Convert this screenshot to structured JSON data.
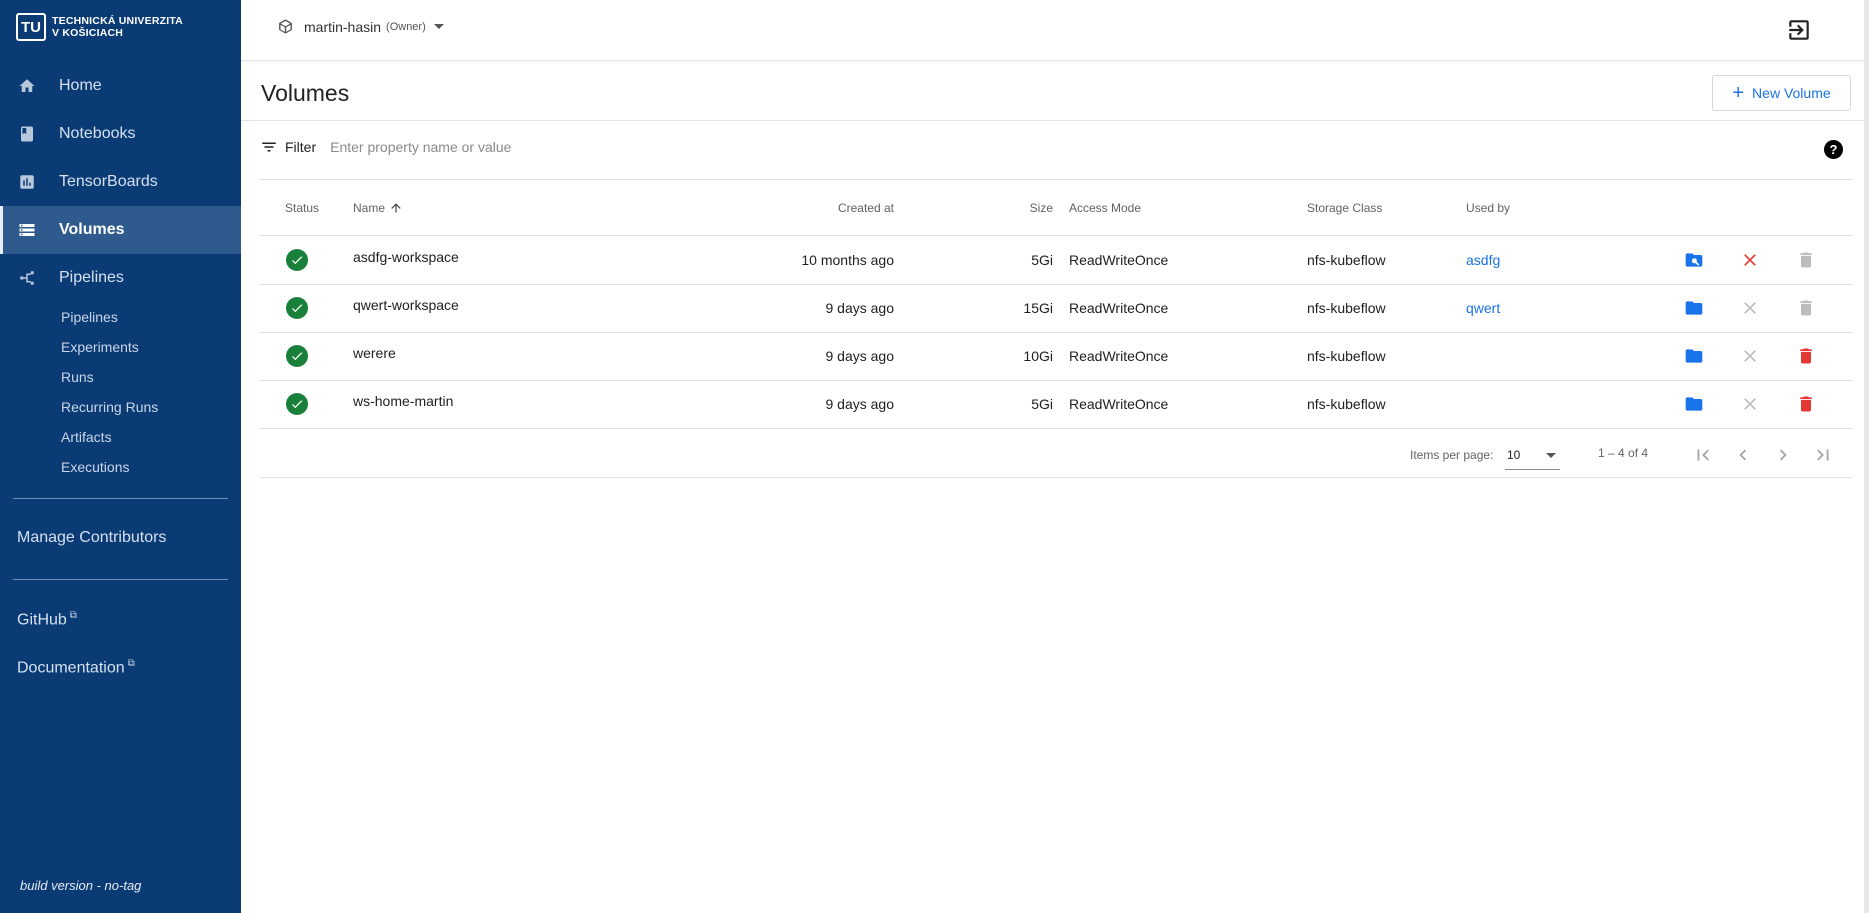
{
  "brand": {
    "logo_mark": "TU",
    "line1": "TECHNICKÁ UNIVERZITA",
    "line2": "V KOŠICIACH"
  },
  "sidebar": {
    "items": [
      {
        "label": "Home",
        "icon": "home-icon"
      },
      {
        "label": "Notebooks",
        "icon": "book-icon"
      },
      {
        "label": "TensorBoards",
        "icon": "chart-icon"
      },
      {
        "label": "Volumes",
        "icon": "list-icon",
        "active": true
      },
      {
        "label": "Pipelines",
        "icon": "pipeline-icon"
      }
    ],
    "sub_items": [
      "Pipelines",
      "Experiments",
      "Runs",
      "Recurring Runs",
      "Artifacts",
      "Executions"
    ],
    "manage_contributors": "Manage Contributors",
    "github": "GitHub",
    "documentation": "Documentation",
    "build_version": "build version - no-tag"
  },
  "topbar": {
    "namespace": "martin-hasin",
    "role": "(Owner)"
  },
  "page": {
    "title": "Volumes",
    "new_button": "New Volume"
  },
  "filter": {
    "label": "Filter",
    "placeholder": "Enter property name or value"
  },
  "table": {
    "headers": {
      "status": "Status",
      "name": "Name",
      "created": "Created at",
      "size": "Size",
      "access": "Access Mode",
      "storage": "Storage Class",
      "used_by": "Used by"
    },
    "rows": [
      {
        "name": "asdfg-workspace",
        "created": "10 months ago",
        "size": "5Gi",
        "access": "ReadWriteOnce",
        "storage": "nfs-kubeflow",
        "used_by": "asdfg",
        "browse": "folder-search-icon",
        "close_active": true,
        "delete_active": false
      },
      {
        "name": "qwert-workspace",
        "created": "9 days ago",
        "size": "15Gi",
        "access": "ReadWriteOnce",
        "storage": "nfs-kubeflow",
        "used_by": "qwert",
        "browse": "folder-icon",
        "close_active": false,
        "delete_active": false
      },
      {
        "name": "werere",
        "created": "9 days ago",
        "size": "10Gi",
        "access": "ReadWriteOnce",
        "storage": "nfs-kubeflow",
        "used_by": "",
        "browse": "folder-icon",
        "close_active": false,
        "delete_active": true
      },
      {
        "name": "ws-home-martin",
        "created": "9 days ago",
        "size": "5Gi",
        "access": "ReadWriteOnce",
        "storage": "nfs-kubeflow",
        "used_by": "",
        "browse": "folder-icon",
        "close_active": false,
        "delete_active": true
      }
    ]
  },
  "paginator": {
    "items_per_page_label": "Items per page:",
    "page_size": "10",
    "range": "1 – 4 of 4"
  },
  "colors": {
    "sidebar": "#0a3b74",
    "accent": "#1a73e8",
    "success": "#188038",
    "danger": "#e53935",
    "disabled": "#bdbdbd"
  }
}
